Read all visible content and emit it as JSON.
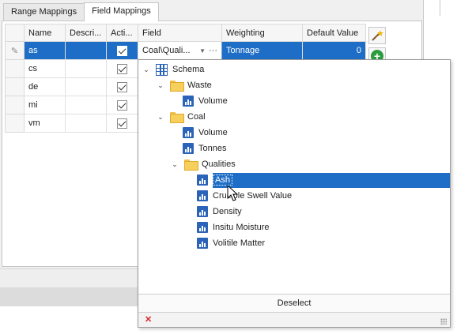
{
  "tabs": [
    {
      "label": "Range Mappings",
      "active": false
    },
    {
      "label": "Field Mappings",
      "active": true
    }
  ],
  "grid": {
    "columns": [
      "Name",
      "Descri...",
      "Acti...",
      "Field",
      "Weighting",
      "Default Value"
    ],
    "rows": [
      {
        "name": "as",
        "desc": "",
        "active": true,
        "field": "Coal\\Quali...",
        "weighting": "Tonnage",
        "default": "0",
        "selected": true
      },
      {
        "name": "cs",
        "desc": "",
        "active": true,
        "field": "",
        "weighting": "",
        "default": "",
        "selected": false
      },
      {
        "name": "de",
        "desc": "",
        "active": true,
        "field": "",
        "weighting": "",
        "default": "",
        "selected": false
      },
      {
        "name": "mi",
        "desc": "",
        "active": true,
        "field": "",
        "weighting": "",
        "default": "",
        "selected": false
      },
      {
        "name": "vm",
        "desc": "",
        "active": true,
        "field": "",
        "weighting": "",
        "default": "",
        "selected": false
      }
    ]
  },
  "tree": {
    "root": "Schema",
    "waste": "Waste",
    "waste_volume": "Volume",
    "coal": "Coal",
    "coal_volume": "Volume",
    "coal_tonnes": "Tonnes",
    "qualities": "Qualities",
    "ash": "Ash",
    "crucible": "Crucible Swell Value",
    "density": "Density",
    "insitu": "Insitu Moisture",
    "volatile": "Volitile Matter"
  },
  "popup": {
    "deselect_label": "Deselect"
  },
  "colors": {
    "selection": "#1e6ec7",
    "folder": "#f6cf5c",
    "field_icon": "#2a63b8"
  }
}
